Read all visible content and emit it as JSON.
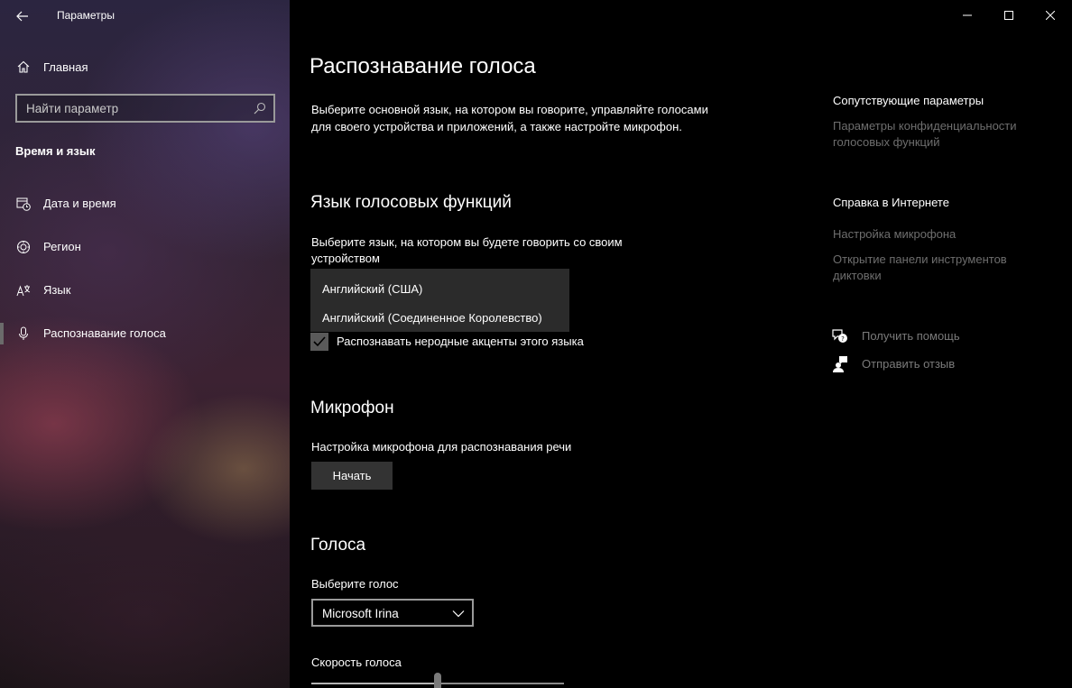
{
  "window": {
    "title": "Параметры",
    "back_icon": "back-arrow-icon",
    "controls": [
      "minimize-icon",
      "maximize-icon",
      "close-icon"
    ]
  },
  "sidebar": {
    "home_label": "Главная",
    "search_placeholder": "Найти параметр",
    "section_title": "Время и язык",
    "items": [
      {
        "label": "Дата и время",
        "icon": "calendar-clock-icon",
        "selected": false
      },
      {
        "label": "Регион",
        "icon": "globe-icon",
        "selected": false
      },
      {
        "label": "Язык",
        "icon": "language-icon",
        "selected": false
      },
      {
        "label": "Распознавание голоса",
        "icon": "microphone-icon",
        "selected": true
      }
    ]
  },
  "main": {
    "title": "Распознавание голоса",
    "description": "Выберите основной язык, на котором вы говорите, управляйте голосами для своего устройства и приложений, а также настройте микрофон.",
    "speech_language": {
      "heading": "Язык голосовых функций",
      "prompt": "Выберите язык, на котором вы будете говорить со своим устройством",
      "options": [
        "Английский (США)",
        "Английский (Соединенное Королевство)"
      ],
      "checkbox_label": "Распознавать неродные акценты этого языка",
      "checkbox_checked": true
    },
    "microphone": {
      "heading": "Микрофон",
      "prompt": "Настройка микрофона для распознавания речи",
      "button_label": "Начать"
    },
    "voices": {
      "heading": "Голоса",
      "select_label": "Выберите голос",
      "selected_voice": "Microsoft Irina",
      "speed_label": "Скорость голоса",
      "speed_level": 0.5
    }
  },
  "related": {
    "heading": "Сопутствующие параметры",
    "privacy_link": "Параметры конфиденциальности голосовых функций",
    "web_help_heading": "Справка в Интернете",
    "mic_setup_link": "Настройка микрофона",
    "dictation_link": "Открытие панели инструментов диктовки",
    "get_help": "Получить помощь",
    "send_feedback": "Отправить отзыв"
  }
}
